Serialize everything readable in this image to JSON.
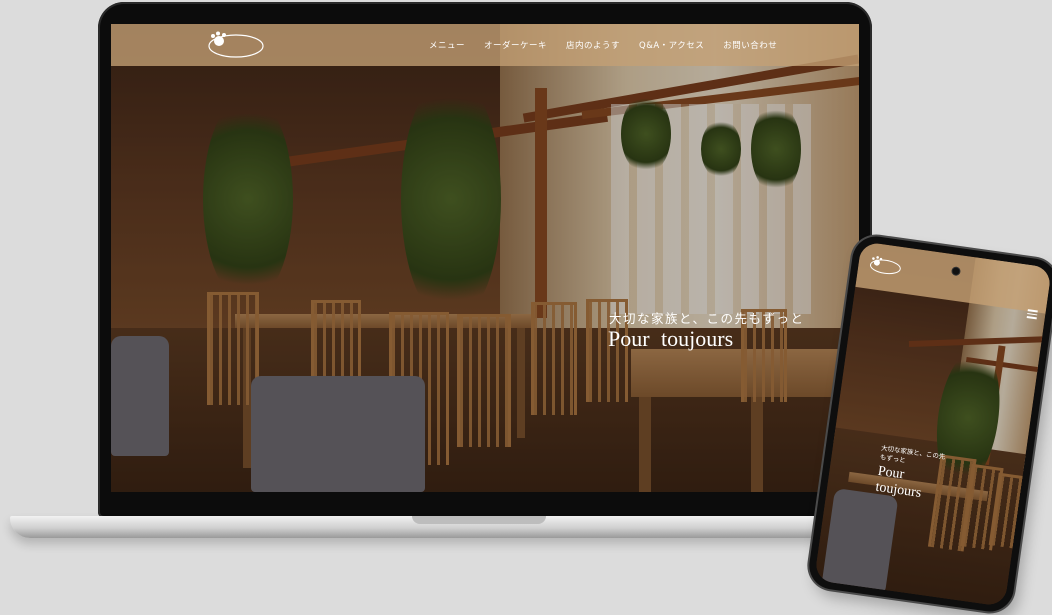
{
  "site": {
    "logo_text": "Pour toujours"
  },
  "nav": [
    {
      "label": "メニュー"
    },
    {
      "label": "オーダーケーキ"
    },
    {
      "label": "店内のようす"
    },
    {
      "label": "Q&A・アクセス"
    },
    {
      "label": "お問い合わせ"
    }
  ],
  "hero": {
    "tagline": "大切な家族と、この先もずっと",
    "title": "Pour toujours"
  },
  "mobile": {
    "tagline": "大切な家族と、この先もずっと",
    "title": "Pour toujours"
  },
  "colors": {
    "header": "#c4a074",
    "accent_text": "#ffffff",
    "wood": "#8a4a22"
  },
  "icons": [
    "paw-logo-icon",
    "hamburger-menu-icon",
    "front-camera-icon"
  ]
}
